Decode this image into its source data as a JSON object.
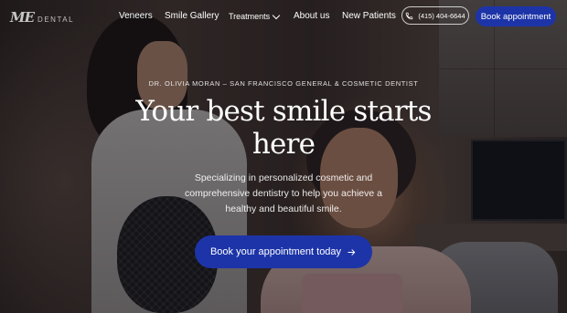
{
  "colors": {
    "accent": "#1d34a8",
    "overlay": "#0e0c12"
  },
  "logo": {
    "mark": "ME",
    "word": "DENTAL"
  },
  "nav": {
    "items": [
      {
        "label": "Veneers"
      },
      {
        "label": "Smile Gallery"
      },
      {
        "label": "Treatments"
      },
      {
        "label": "About us"
      },
      {
        "label": "New Patients"
      }
    ],
    "phone": "(415) 404-6644",
    "phone_icon": "phone-icon",
    "book": "Book appointment"
  },
  "hero": {
    "eyebrow": "DR. OLIVIA MORAN – SAN FRANCISCO GENERAL & COSMETIC DENTIST",
    "headline": "Your best smile starts here",
    "subtext": "Specializing in personalized cosmetic and comprehensive dentistry to help you achieve a healthy and beautiful smile.",
    "cta": "Book your appointment today",
    "cta_icon": "arrow-right-icon"
  }
}
